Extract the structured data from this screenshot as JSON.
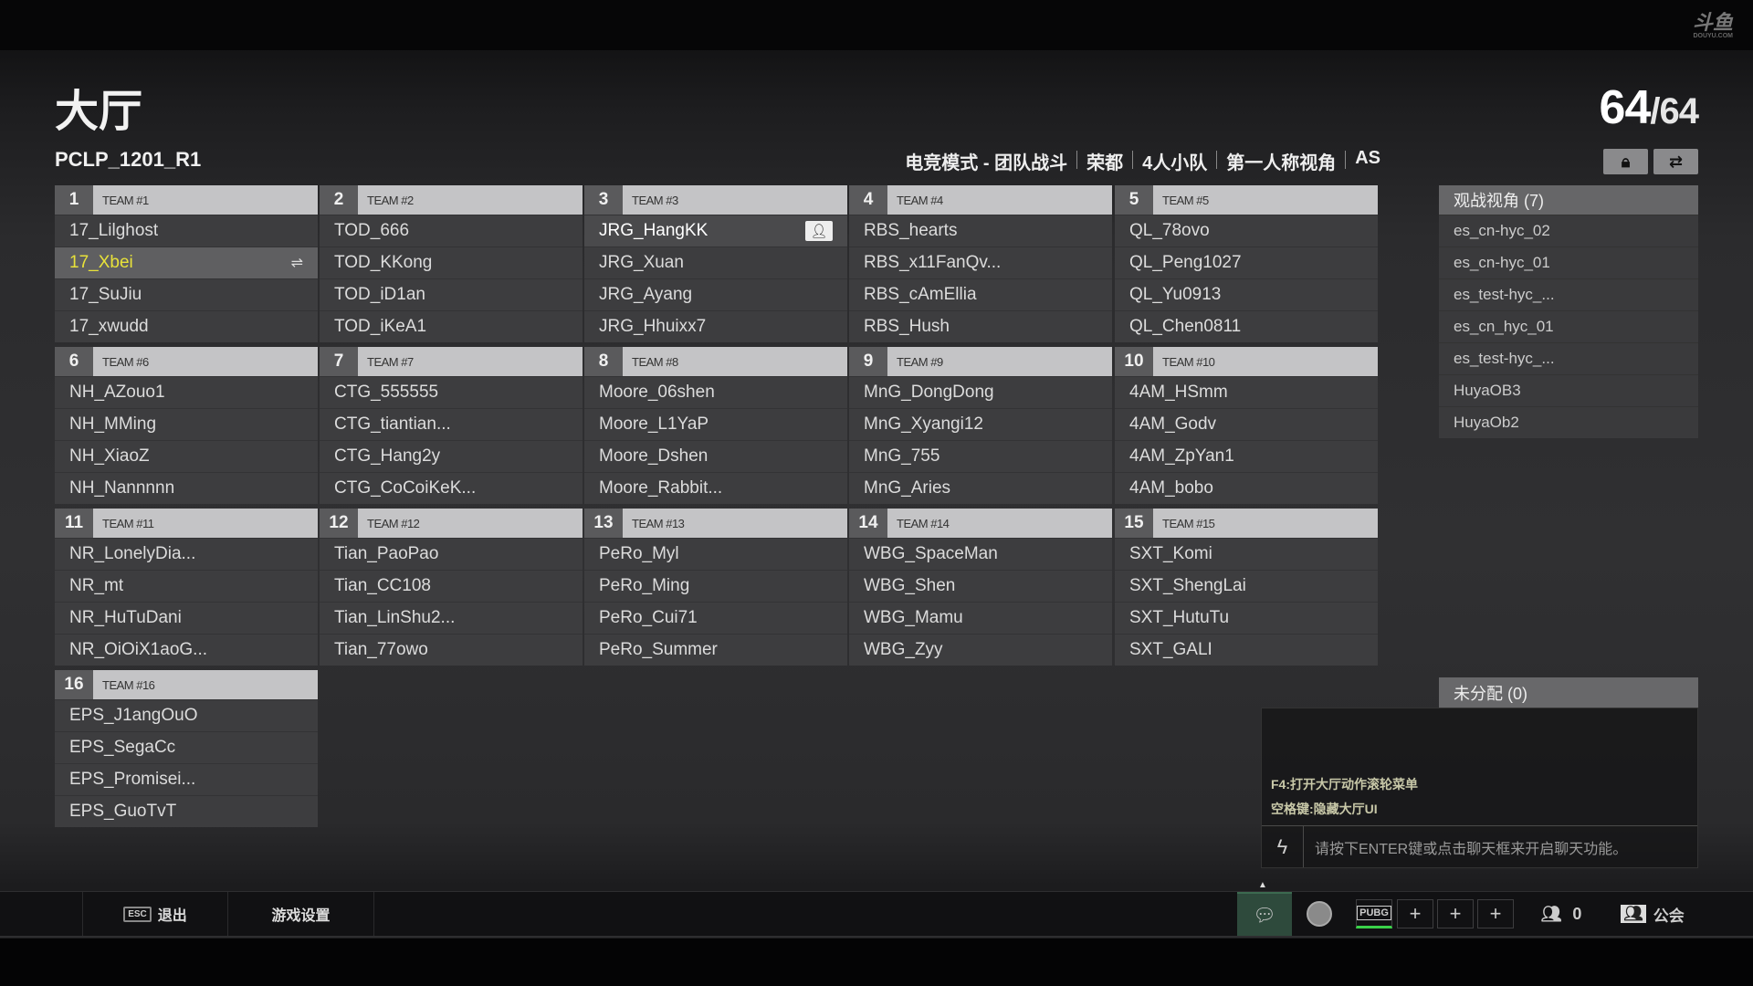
{
  "header": {
    "title": "大厅",
    "room": "PCLP_1201_R1",
    "player_count": "64",
    "player_max": "/64",
    "logo": "斗鱼",
    "logo_sub": "DOUYU.COM",
    "mode": [
      "电竞模式 - 团队战斗",
      "荣都",
      "4人小队",
      "第一人称视角",
      "AS"
    ]
  },
  "teams": [
    {
      "num": "1",
      "name": "TEAM #1",
      "players": [
        "17_Lilghost",
        "17_Xbei",
        "17_SuJiu",
        "17_xwudd"
      ]
    },
    {
      "num": "2",
      "name": "TEAM #2",
      "players": [
        "TOD_666",
        "TOD_KKong",
        "TOD_iD1an",
        "TOD_iKeA1"
      ]
    },
    {
      "num": "3",
      "name": "TEAM #3",
      "players": [
        "JRG_HangKK",
        "JRG_Xuan",
        "JRG_Ayang",
        "JRG_Hhuixx7"
      ]
    },
    {
      "num": "4",
      "name": "TEAM #4",
      "players": [
        "RBS_hearts",
        "RBS_x11FanQv...",
        "RBS_cAmEllia",
        "RBS_Hush"
      ]
    },
    {
      "num": "5",
      "name": "TEAM #5",
      "players": [
        "QL_78ovo",
        "QL_Peng1027",
        "QL_Yu0913",
        "QL_Chen0811"
      ]
    },
    {
      "num": "6",
      "name": "TEAM #6",
      "players": [
        "NH_AZouo1",
        "NH_MMing",
        "NH_XiaoZ",
        "NH_Nannnnn"
      ]
    },
    {
      "num": "7",
      "name": "TEAM #7",
      "players": [
        "CTG_555555",
        "CTG_tiantian...",
        "CTG_Hang2y",
        "CTG_CoCoiKeK..."
      ]
    },
    {
      "num": "8",
      "name": "TEAM #8",
      "players": [
        "Moore_06shen",
        "Moore_L1YaP",
        "Moore_Dshen",
        "Moore_Rabbit..."
      ]
    },
    {
      "num": "9",
      "name": "TEAM #9",
      "players": [
        "MnG_DongDong",
        "MnG_Xyangi12",
        "MnG_755",
        "MnG_Aries"
      ]
    },
    {
      "num": "10",
      "name": "TEAM #10",
      "players": [
        "4AM_HSmm",
        "4AM_Godv",
        "4AM_ZpYan1",
        "4AM_bobo"
      ]
    },
    {
      "num": "11",
      "name": "TEAM #11",
      "players": [
        "NR_LonelyDia...",
        "NR_mt",
        "NR_HuTuDani",
        "NR_OiOiX1aoG..."
      ]
    },
    {
      "num": "12",
      "name": "TEAM #12",
      "players": [
        "Tian_PaoPao",
        "Tian_CC108",
        "Tian_LinShu2...",
        "Tian_77owo"
      ]
    },
    {
      "num": "13",
      "name": "TEAM #13",
      "players": [
        "PeRo_Myl",
        "PeRo_Ming",
        "PeRo_Cui71",
        "PeRo_Summer"
      ]
    },
    {
      "num": "14",
      "name": "TEAM #14",
      "players": [
        "WBG_SpaceMan",
        "WBG_Shen",
        "WBG_Mamu",
        "WBG_Zyy"
      ]
    },
    {
      "num": "15",
      "name": "TEAM #15",
      "players": [
        "SXT_Komi",
        "SXT_ShengLai",
        "SXT_HutuTu",
        "SXT_GALI"
      ]
    },
    {
      "num": "16",
      "name": "TEAM #16",
      "players": [
        "EPS_J1angOuO",
        "EPS_SegaCc",
        "EPS_Promisei...",
        "EPS_GuoTvT"
      ]
    }
  ],
  "selected_player": "17_Xbei",
  "selected_color": "#e8e23a",
  "spectators": {
    "title": "观战视角 (7)",
    "items": [
      "es_cn-hyc_02",
      "es_cn-hyc_01",
      "es_test-hyc_...",
      "es_cn_hyc_01",
      "es_test-hyc_...",
      "HuyaOB3",
      "HuyaOb2"
    ]
  },
  "unassigned": {
    "title": "未分配 (0)"
  },
  "chat": {
    "hints": [
      "F4:打开大厅动作滚轮菜单",
      "空格键:隐藏大厅UI"
    ],
    "placeholder": "请按下ENTER键或点击聊天框来开启聊天功能。"
  },
  "bottom": {
    "esc_key": "ESC",
    "exit": "退出",
    "settings": "游戏设置",
    "pubg": "PUBG",
    "plus": "+",
    "friends_count": "0",
    "guild": "公会"
  }
}
